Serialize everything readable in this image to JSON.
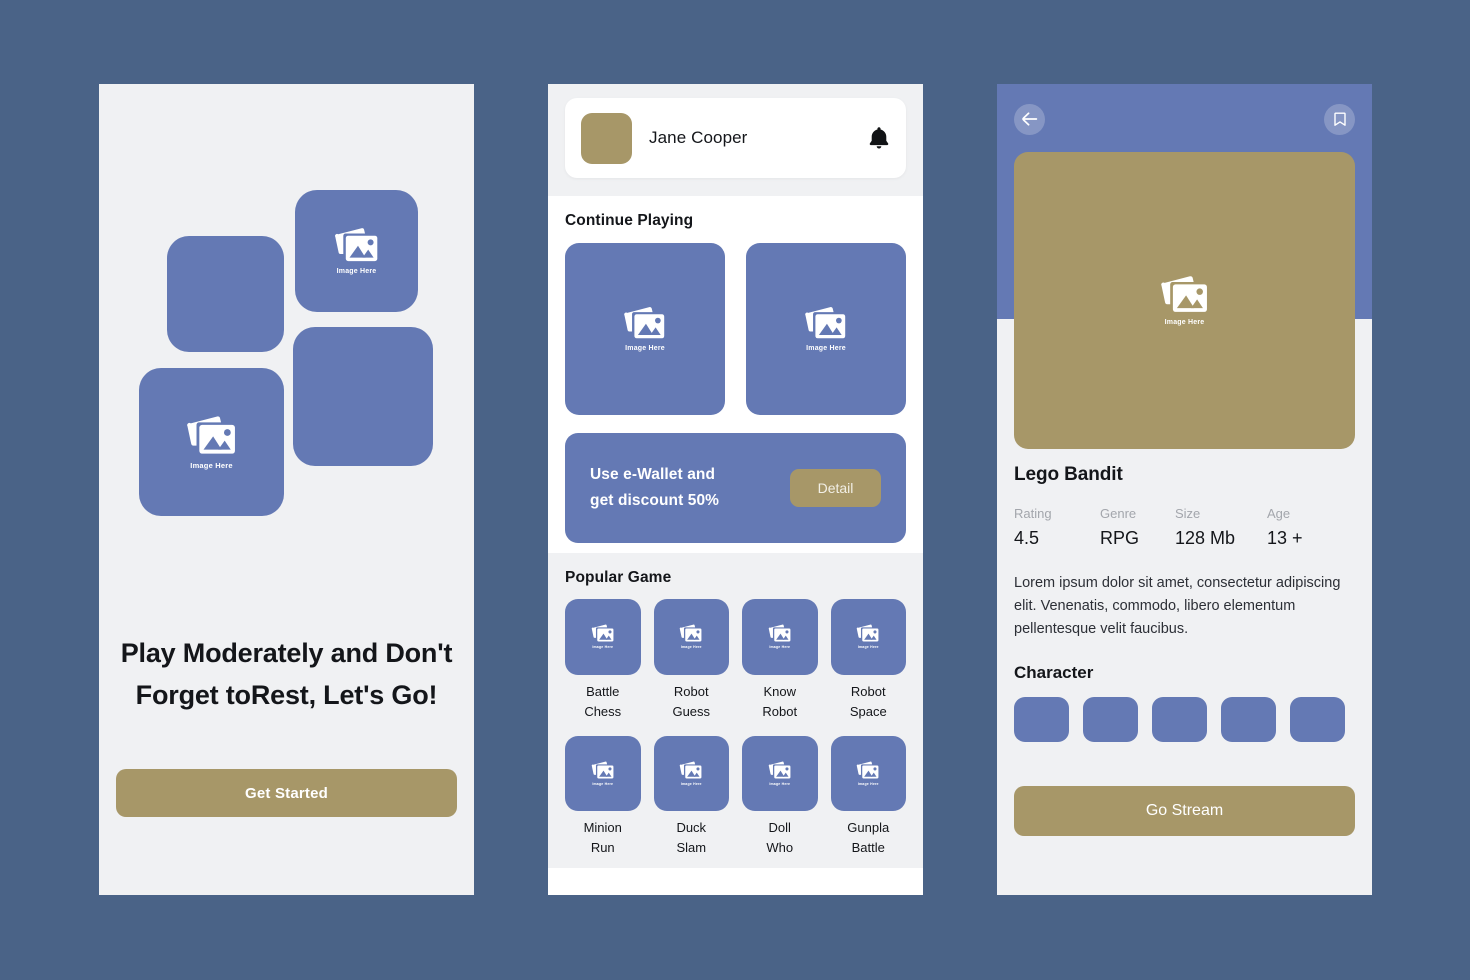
{
  "canvas": {
    "background_color": "#4a6387",
    "accent_blue": "#6479b4",
    "accent_gold": "#a79768",
    "surface": "#f0f1f3"
  },
  "placeholder": {
    "label": "Image Here",
    "icon": "image-placeholder-icon"
  },
  "screen_onboarding": {
    "name": "Onboarding",
    "tiles": [
      {
        "id": "tile-1",
        "has_image": false
      },
      {
        "id": "tile-2",
        "has_image": true,
        "label": "Image Here"
      },
      {
        "id": "tile-3",
        "has_image": false
      },
      {
        "id": "tile-4",
        "has_image": true,
        "label": "Image Here"
      }
    ],
    "headline": "Play Moderately and Don't Forget toRest, Let's Go!",
    "cta_label": "Get Started"
  },
  "screen_home": {
    "name": "Home",
    "profile": {
      "user_name": "Jane Cooper",
      "avatar": "user-avatar",
      "notification_icon": "bell-icon"
    },
    "continue_section": {
      "title": "Continue Playing",
      "cards": [
        {
          "label": "Image Here"
        },
        {
          "label": "Image Here"
        }
      ]
    },
    "promo": {
      "line1": "Use e-Wallet and",
      "line2": "get discount 50%",
      "button_label": "Detail"
    },
    "popular_section": {
      "title": "Popular Game",
      "games": [
        {
          "label": "Battle\nChess",
          "thumb_label": "Image Here"
        },
        {
          "label": "Robot\nGuess",
          "thumb_label": "Image Here"
        },
        {
          "label": "Know\nRobot",
          "thumb_label": "Image Here"
        },
        {
          "label": "Robot\nSpace",
          "thumb_label": "Image Here"
        },
        {
          "label": "Minion\nRun",
          "thumb_label": "Image Here"
        },
        {
          "label": "Duck\nSlam",
          "thumb_label": "Image Here"
        },
        {
          "label": "Doll\nWho",
          "thumb_label": "Image Here"
        },
        {
          "label": "Gunpla\nBattle",
          "thumb_label": "Image Here"
        }
      ]
    }
  },
  "screen_detail": {
    "name": "Game Detail",
    "back_icon": "arrow-left-icon",
    "bookmark_icon": "bookmark-icon",
    "hero": {
      "label": "Image Here"
    },
    "title": "Lego Bandit",
    "stats": [
      {
        "key": "Rating",
        "value": "4.5"
      },
      {
        "key": "Genre",
        "value": "RPG"
      },
      {
        "key": "Size",
        "value": "128 Mb"
      },
      {
        "key": "Age",
        "value": "13 +"
      }
    ],
    "description": "Lorem ipsum dolor sit amet, consectetur adipiscing elit. Venenatis, commodo, libero elementum pellentesque velit faucibus.",
    "character_title": "Character",
    "characters": [
      {
        "id": "char-1"
      },
      {
        "id": "char-2"
      },
      {
        "id": "char-3"
      },
      {
        "id": "char-4"
      },
      {
        "id": "char-5"
      }
    ],
    "cta_label": "Go Stream"
  }
}
